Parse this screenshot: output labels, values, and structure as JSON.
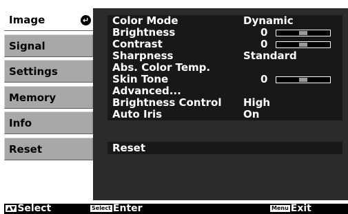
{
  "tabs": [
    {
      "label": "Image",
      "active": true
    },
    {
      "label": "Signal",
      "active": false
    },
    {
      "label": "Settings",
      "active": false
    },
    {
      "label": "Memory",
      "active": false
    },
    {
      "label": "Info",
      "active": false
    },
    {
      "label": "Reset",
      "active": false
    }
  ],
  "image_menu": {
    "color_mode": {
      "label": "Color Mode",
      "value": "Dynamic"
    },
    "brightness": {
      "label": "Brightness",
      "value": "0",
      "level": 0.5
    },
    "contrast": {
      "label": "Contrast",
      "value": "0",
      "level": 0.5
    },
    "sharpness": {
      "label": "Sharpness",
      "value": "Standard"
    },
    "abs_color_temp": {
      "label": "Abs. Color Temp."
    },
    "skin_tone": {
      "label": "Skin Tone",
      "value": "0",
      "level": 0.5
    },
    "advanced": {
      "label": "Advanced..."
    },
    "brightness_control": {
      "label": "Brightness Control",
      "value": "High"
    },
    "auto_iris": {
      "label": "Auto Iris",
      "value": "On"
    },
    "reset": {
      "label": "Reset"
    }
  },
  "helpbar": {
    "select_key": "▲▼",
    "select_label": "Select",
    "enter_key": "Select",
    "enter_label": "Enter",
    "exit_key": "Menu",
    "exit_label": "Exit"
  },
  "icons": {
    "active_tab": "enter-arrow-icon"
  },
  "colors": {
    "panel": "#2b2b2b",
    "row_bg": "#181818",
    "tab_inactive": "#a8a8a8",
    "tab_active": "#ffffff"
  }
}
